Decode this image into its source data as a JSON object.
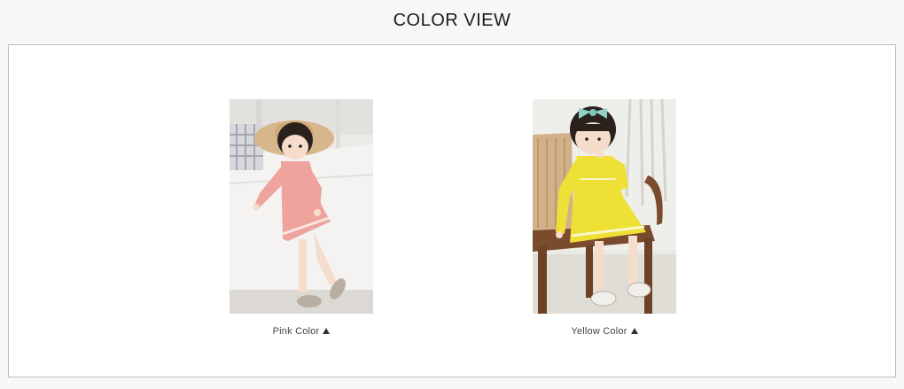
{
  "page": {
    "title": "COLOR VIEW"
  },
  "items": [
    {
      "caption_text": "Pink Color",
      "color_name": "pink",
      "accent": "#f0a6a0"
    },
    {
      "caption_text": "Yellow Color",
      "color_name": "yellow",
      "accent": "#f0e035"
    }
  ],
  "icons": {
    "caption_marker": "triangle-up-icon"
  }
}
